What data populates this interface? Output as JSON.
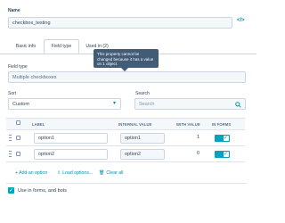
{
  "name_label": "Name",
  "name_value": "checkbox_testing",
  "code_icon": "</>",
  "tabs": [
    {
      "label": "Basic info"
    },
    {
      "label": "Field type"
    },
    {
      "label": "Used in (2)"
    }
  ],
  "tooltip": "This property cannot be changed because it has a value on 1 object.",
  "field_type_label": "Field type",
  "field_type_value": "Multiple checkboxes",
  "sort_label": "Sort",
  "sort_value": "Custom",
  "search_label": "Search",
  "search_placeholder": "Search",
  "table": {
    "headers": [
      "LABEL",
      "INTERNAL VALUE",
      "WITH VALUE",
      "IN FORMS"
    ],
    "rows": [
      {
        "label": "option1",
        "internal": "option1",
        "count": "1"
      },
      {
        "label": "option2",
        "internal": "option2",
        "count": "0"
      }
    ]
  },
  "actions": {
    "add": "+ Add an option",
    "load": "Load options...",
    "clear": "Clear all"
  },
  "footer_checkbox_label": "Use in forms, and bots",
  "colors": {
    "accent": "#00a4bd",
    "link": "#0091ae",
    "tooltip": "#425b76"
  }
}
